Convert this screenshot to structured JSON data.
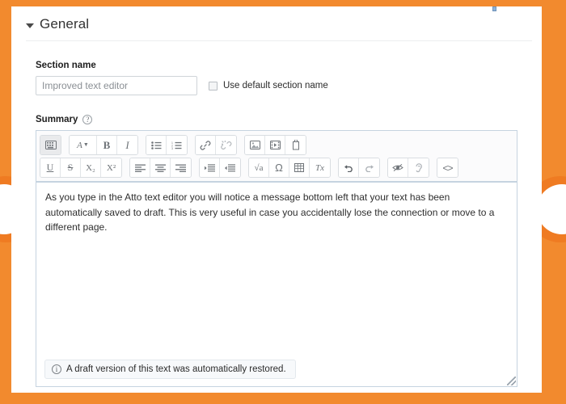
{
  "theme": {
    "page_background": "#f28a2e",
    "blob_color": "#ef7b22",
    "panel_background": "#ffffff",
    "editor_border": "#c6d3e0"
  },
  "section": {
    "collapse_icon": "caret-down-icon",
    "title": "General"
  },
  "form": {
    "section_name": {
      "label": "Section name",
      "value": "Improved text editor",
      "placeholder": "Improved text editor"
    },
    "use_default": {
      "label": "Use default section name",
      "checked": false
    },
    "summary": {
      "label": "Summary",
      "help_icon": "help-circle-icon",
      "help_glyph": "?"
    }
  },
  "toolbar": {
    "row1": [
      {
        "group": [
          {
            "name": "toggle-toolbar",
            "icon": "keyboard-icon",
            "active": true
          }
        ]
      },
      {
        "group": [
          {
            "name": "style",
            "icon": "text-style-icon",
            "glyph": "A"
          },
          {
            "name": "bold",
            "icon": "bold-icon",
            "glyph": "B"
          },
          {
            "name": "italic",
            "icon": "italic-icon",
            "glyph": "I"
          }
        ]
      },
      {
        "group": [
          {
            "name": "bullet-list",
            "icon": "bullet-list-icon"
          },
          {
            "name": "numbered-list",
            "icon": "numbered-list-icon"
          }
        ]
      },
      {
        "group": [
          {
            "name": "link",
            "icon": "link-icon"
          },
          {
            "name": "unlink",
            "icon": "unlink-icon"
          }
        ]
      },
      {
        "group": [
          {
            "name": "insert-image",
            "icon": "image-icon"
          },
          {
            "name": "insert-media",
            "icon": "media-icon"
          },
          {
            "name": "manage-files",
            "icon": "manage-files-icon"
          }
        ]
      }
    ],
    "row2": [
      {
        "group": [
          {
            "name": "underline",
            "icon": "underline-icon",
            "glyph": "U"
          },
          {
            "name": "strikethrough",
            "icon": "strikethrough-icon",
            "glyph": "S"
          },
          {
            "name": "subscript",
            "icon": "subscript-icon",
            "glyph": "X₂"
          },
          {
            "name": "superscript",
            "icon": "superscript-icon",
            "glyph": "X²"
          }
        ]
      },
      {
        "group": [
          {
            "name": "align-left",
            "icon": "align-left-icon"
          },
          {
            "name": "align-center",
            "icon": "align-center-icon"
          },
          {
            "name": "align-right",
            "icon": "align-right-icon"
          }
        ]
      },
      {
        "group": [
          {
            "name": "indent",
            "icon": "indent-icon"
          },
          {
            "name": "outdent",
            "icon": "outdent-icon"
          }
        ]
      },
      {
        "group": [
          {
            "name": "equation",
            "icon": "equation-icon",
            "glyph": "√a"
          },
          {
            "name": "special-character",
            "icon": "omega-icon",
            "glyph": "Ω"
          },
          {
            "name": "table",
            "icon": "table-icon"
          },
          {
            "name": "clear-formatting",
            "icon": "clear-formatting-icon",
            "glyph": "Tx"
          }
        ]
      },
      {
        "group": [
          {
            "name": "undo",
            "icon": "undo-icon"
          },
          {
            "name": "redo",
            "icon": "redo-icon"
          }
        ]
      },
      {
        "group": [
          {
            "name": "accessibility-checker",
            "icon": "eye-icon"
          },
          {
            "name": "screenreader-helper",
            "icon": "ear-icon"
          }
        ]
      },
      {
        "group": [
          {
            "name": "html-source",
            "icon": "code-icon",
            "glyph": "<>"
          }
        ]
      }
    ]
  },
  "editor": {
    "body_text": "As you type in the Atto text editor you will notice a message bottom left that your text has been automatically saved to draft. This is very useful in case you accidentally lose the connection or move to a different page."
  },
  "notice": {
    "icon": "info-circle-icon",
    "icon_glyph": "i",
    "text": "A draft version of this text was automatically restored."
  }
}
